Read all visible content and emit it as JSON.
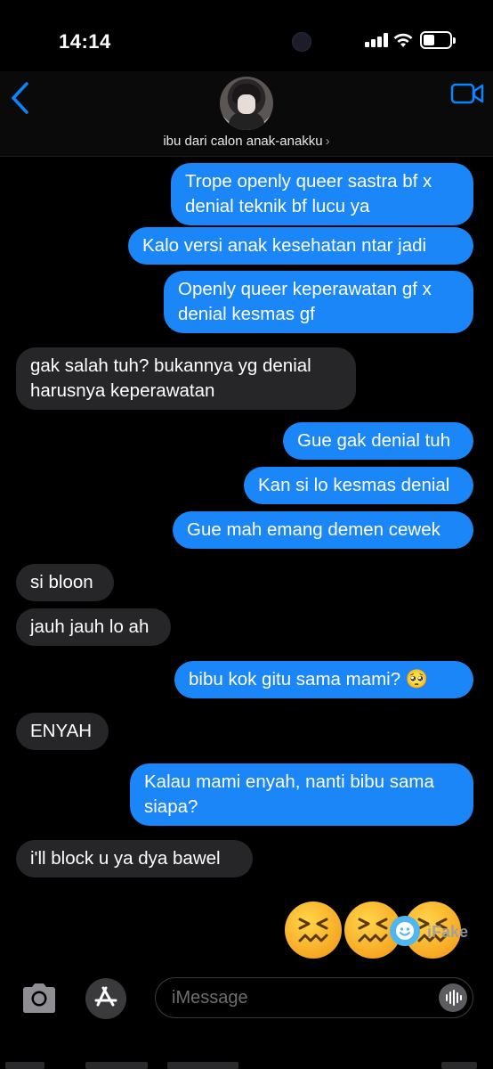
{
  "status_bar": {
    "time": "14:14"
  },
  "header": {
    "contact_name": "ibu dari calon anak-anakku",
    "chevron": "›"
  },
  "messages": [
    {
      "from": "me",
      "lines": [
        "Trope openly queer sastra bf x",
        "denial teknik bf lucu ya"
      ]
    },
    {
      "from": "me",
      "lines": [
        "Kalo versi anak kesehatan ntar jadi"
      ]
    },
    {
      "from": "me",
      "lines": [
        "Openly queer keperawatan gf x",
        "denial kesmas gf"
      ]
    },
    {
      "from": "them",
      "lines": [
        "gak salah tuh? bukannya yg denial",
        "harusnya keperawatan"
      ]
    },
    {
      "from": "me",
      "lines": [
        "Gue gak denial tuh"
      ]
    },
    {
      "from": "me",
      "lines": [
        "Kan si lo kesmas denial"
      ]
    },
    {
      "from": "me",
      "lines": [
        "Gue mah emang demen cewek"
      ]
    },
    {
      "from": "them",
      "lines": [
        "si bloon"
      ]
    },
    {
      "from": "them",
      "lines": [
        "jauh jauh lo ah"
      ]
    },
    {
      "from": "me",
      "lines": [
        "bibu kok gitu sama mami? 🥺"
      ]
    },
    {
      "from": "them",
      "lines": [
        "ENYAH"
      ]
    },
    {
      "from": "me",
      "lines": [
        "Kalau mami enyah, nanti bibu sama",
        "siapa?"
      ]
    },
    {
      "from": "them",
      "lines": [
        "i'll block u ya dya bawel"
      ]
    }
  ],
  "emoji_reply": {
    "icon": "confounded-face",
    "count": 3
  },
  "watermark": "iFake",
  "input": {
    "placeholder": "iMessage"
  },
  "colors": {
    "outgoing": "#1b86f8",
    "incoming": "#262628",
    "accent": "#0a84ff"
  }
}
